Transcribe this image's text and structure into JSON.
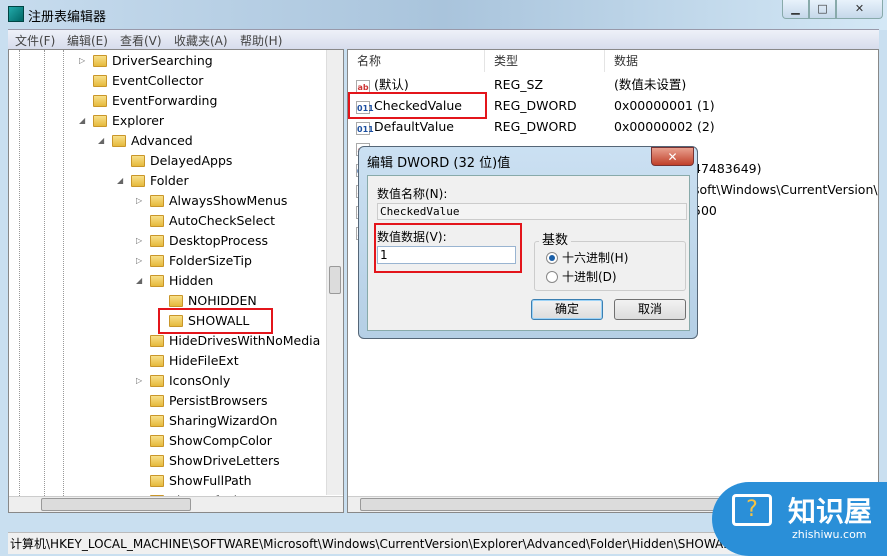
{
  "window": {
    "title": "注册表编辑器",
    "minimize": "▁",
    "maximize": "□",
    "close": "✕"
  },
  "menu": [
    "文件(F)",
    "编辑(E)",
    "查看(V)",
    "收藏夹(A)",
    "帮助(H)"
  ],
  "tree": [
    {
      "label": "DriverSearching",
      "level": 0,
      "arrow": "▷"
    },
    {
      "label": "EventCollector",
      "level": 0,
      "arrow": ""
    },
    {
      "label": "EventForwarding",
      "level": 0,
      "arrow": ""
    },
    {
      "label": "Explorer",
      "level": 0,
      "arrow": "◢"
    },
    {
      "label": "Advanced",
      "level": 1,
      "arrow": "◢"
    },
    {
      "label": "DelayedApps",
      "level": 2,
      "arrow": ""
    },
    {
      "label": "Folder",
      "level": 2,
      "arrow": "◢"
    },
    {
      "label": "AlwaysShowMenus",
      "level": 3,
      "arrow": "▷"
    },
    {
      "label": "AutoCheckSelect",
      "level": 3,
      "arrow": ""
    },
    {
      "label": "DesktopProcess",
      "level": 3,
      "arrow": "▷"
    },
    {
      "label": "FolderSizeTip",
      "level": 3,
      "arrow": "▷"
    },
    {
      "label": "Hidden",
      "level": 3,
      "arrow": "◢"
    },
    {
      "label": "NOHIDDEN",
      "level": 4,
      "arrow": ""
    },
    {
      "label": "SHOWALL",
      "level": 4,
      "arrow": ""
    },
    {
      "label": "HideDrivesWithNoMedia",
      "level": 3,
      "arrow": ""
    },
    {
      "label": "HideFileExt",
      "level": 3,
      "arrow": ""
    },
    {
      "label": "IconsOnly",
      "level": 3,
      "arrow": "▷"
    },
    {
      "label": "PersistBrowsers",
      "level": 3,
      "arrow": ""
    },
    {
      "label": "SharingWizardOn",
      "level": 3,
      "arrow": ""
    },
    {
      "label": "ShowCompColor",
      "level": 3,
      "arrow": ""
    },
    {
      "label": "ShowDriveLetters",
      "level": 3,
      "arrow": ""
    },
    {
      "label": "ShowFullPath",
      "level": 3,
      "arrow": ""
    },
    {
      "label": "ShowInfoTip",
      "level": 3,
      "arrow": ""
    }
  ],
  "list": {
    "headers": {
      "name": "名称",
      "type": "类型",
      "data": "数据"
    },
    "rows": [
      {
        "icon": "ab",
        "name": "(默认)",
        "type": "REG_SZ",
        "data": "(数值未设置)"
      },
      {
        "icon": "dword",
        "name": "CheckedValue",
        "type": "REG_DWORD",
        "data": "0x00000001 (1)"
      },
      {
        "icon": "dword",
        "name": "DefaultValue",
        "type": "REG_DWORD",
        "data": "0x00000002 (2)"
      },
      {
        "icon": "ab",
        "name": "",
        "type": "",
        "data": ""
      },
      {
        "icon": "dword",
        "name": "",
        "type": "",
        "data": "47483649)"
      },
      {
        "icon": "ab",
        "name": "",
        "type": "",
        "data": "soft\\Windows\\CurrentVersion\\."
      },
      {
        "icon": "ab",
        "name": "",
        "type": "",
        "data": "500"
      },
      {
        "icon": "ab",
        "name": "",
        "type": "",
        "data": ""
      }
    ]
  },
  "dialog": {
    "title": "编辑 DWORD (32 位)值",
    "name_label": "数值名称(N):",
    "name_value": "CheckedValue",
    "data_label": "数值数据(V):",
    "data_value": "1",
    "base_label": "基数",
    "hex": "十六进制(H)",
    "dec": "十进制(D)",
    "base_selected": "hex",
    "ok": "确定",
    "cancel": "取消"
  },
  "status": "计算机\\HKEY_LOCAL_MACHINE\\SOFTWARE\\Microsoft\\Windows\\CurrentVersion\\Explorer\\Advanced\\Folder\\Hidden\\SHOWALL",
  "watermark": {
    "brand": "知识屋",
    "url": "zhishiwu.com"
  },
  "colors": {
    "highlight": "#e3151b",
    "selected_radio": "#1a5fa8"
  }
}
